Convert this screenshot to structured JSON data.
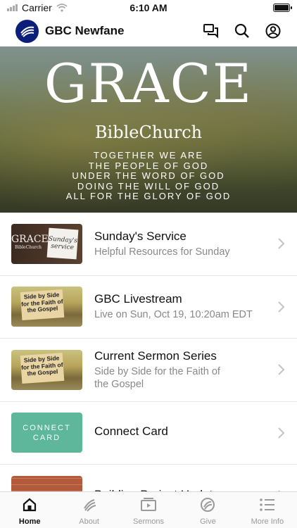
{
  "status_bar": {
    "carrier": "Carrier",
    "time": "6:10 AM"
  },
  "header": {
    "title": "GBC Newfane"
  },
  "hero": {
    "title": "GRACE",
    "subtitle": "BibleChurch",
    "lines": [
      "TOGETHER WE ARE",
      "THE PEOPLE OF GOD",
      "UNDER THE WORD OF GOD",
      "DOING THE WILL OF GOD",
      "ALL FOR THE GLORY OF GOD"
    ]
  },
  "list": [
    {
      "title": "Sunday's Service",
      "subtitle": "Helpful Resources for Sunday",
      "thumb": {
        "grace": "GRACE",
        "church": "BibleChurch",
        "card_text": "Sunday's service"
      }
    },
    {
      "title": "GBC Livestream",
      "subtitle": "Live on Sun, Oct 19, 10:20am EDT",
      "thumb": {
        "sign_text": "Side by Side for the Faith of the Gospel"
      }
    },
    {
      "title": "Current Sermon Series",
      "subtitle": "Side by Side for the Faith of the Gospel",
      "thumb": {
        "sign_text": "Side by Side for the Faith of the Gospel"
      }
    },
    {
      "title": "Connect Card",
      "subtitle": "",
      "thumb": {
        "text": "CONNECT CARD"
      }
    },
    {
      "title": "Building Project Update",
      "subtitle": "",
      "thumb": {}
    }
  ],
  "tabs": [
    {
      "label": "Home",
      "icon": "home-icon",
      "active": true
    },
    {
      "label": "About",
      "icon": "about-icon",
      "active": false
    },
    {
      "label": "Sermons",
      "icon": "sermons-icon",
      "active": false
    },
    {
      "label": "Give",
      "icon": "give-icon",
      "active": false
    },
    {
      "label": "More Info",
      "icon": "more-info-icon",
      "active": false
    }
  ],
  "colors": {
    "logo_bg": "#0b1f7a",
    "connect_card": "#5eb79a",
    "inactive_tab": "#9a9a9a"
  }
}
